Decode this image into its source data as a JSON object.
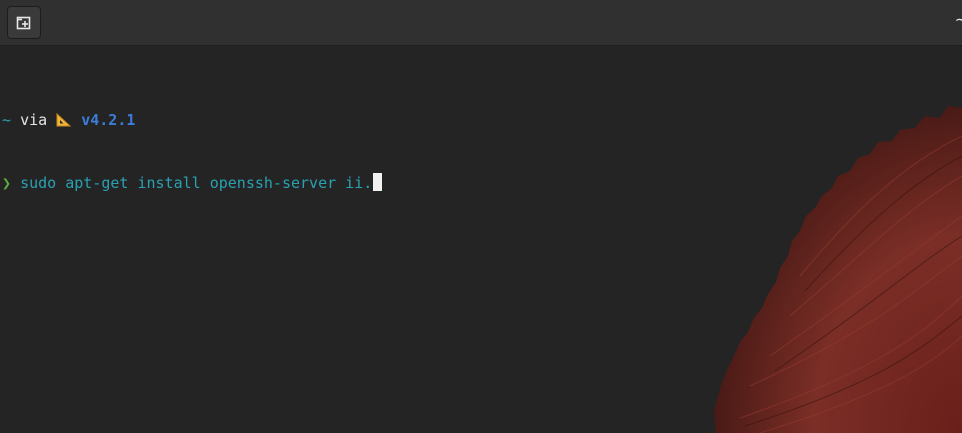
{
  "window": {
    "title": "~",
    "new_tab_icon": "new-tab-icon"
  },
  "prompt": {
    "directory": "~",
    "via_text": "via",
    "runtime_icon": "triangular-ruler-icon",
    "runtime_version": "v4.2.1",
    "symbol": "❯",
    "command": "sudo apt-get install openssh-server ii."
  },
  "colors": {
    "background": "#242424",
    "titlebar": "#303030",
    "directory": "#2aa1b3",
    "version": "#3b7dd8",
    "prompt_symbol": "#5aaf3c",
    "command": "#2aa1b3",
    "wallpaper_accent": "#7a2a22"
  }
}
